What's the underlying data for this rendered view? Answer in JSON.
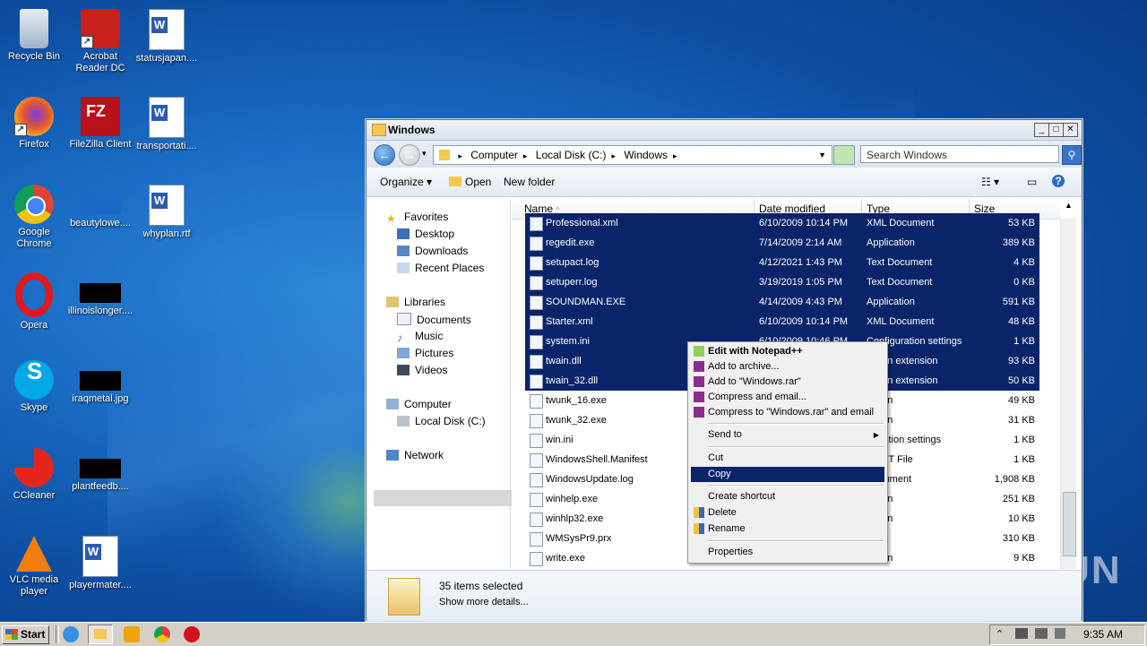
{
  "desktop": {
    "icons": [
      {
        "label": "Recycle Bin",
        "icon": "recycle-bin-icon"
      },
      {
        "label": "Acrobat Reader DC",
        "icon": "acrobat-icon"
      },
      {
        "label": "statusjapan....",
        "icon": "word-doc-icon"
      },
      {
        "label": "Firefox",
        "icon": "firefox-icon"
      },
      {
        "label": "FileZilla Client",
        "icon": "filezilla-icon"
      },
      {
        "label": "transportati....",
        "icon": "word-doc-icon"
      },
      {
        "label": "Google Chrome",
        "icon": "chrome-icon"
      },
      {
        "label": "beautylowe....",
        "icon": "file-icon"
      },
      {
        "label": "whyplan.rtf",
        "icon": "word-doc-icon"
      },
      {
        "label": "Opera",
        "icon": "opera-icon"
      },
      {
        "label": "illinoislonger....",
        "icon": "file-icon"
      },
      {
        "label": "Skype",
        "icon": "skype-icon"
      },
      {
        "label": "iraqmetal.jpg",
        "icon": "image-icon"
      },
      {
        "label": "CCleaner",
        "icon": "ccleaner-icon"
      },
      {
        "label": "plantfeedb....",
        "icon": "file-icon"
      },
      {
        "label": "VLC media player",
        "icon": "vlc-icon"
      },
      {
        "label": "playermater....",
        "icon": "word-doc-icon"
      }
    ]
  },
  "window": {
    "title": "Windows",
    "breadcrumb": [
      "Computer",
      "Local Disk (C:)",
      "Windows"
    ],
    "search_placeholder": "Search Windows",
    "toolbar": {
      "organize": "Organize",
      "open": "Open",
      "new_folder": "New folder"
    },
    "nav": {
      "favorites": "Favorites",
      "desktop": "Desktop",
      "downloads": "Downloads",
      "recent": "Recent Places",
      "libraries": "Libraries",
      "documents": "Documents",
      "music": "Music",
      "pictures": "Pictures",
      "videos": "Videos",
      "computer": "Computer",
      "local_disk": "Local Disk (C:)",
      "network": "Network"
    },
    "columns": {
      "name": "Name",
      "date": "Date modified",
      "type": "Type",
      "size": "Size"
    },
    "rows": [
      {
        "name": "Professional.xml",
        "date": "6/10/2009 10:14 PM",
        "type": "XML Document",
        "size": "53 KB"
      },
      {
        "name": "regedit.exe",
        "date": "7/14/2009 2:14 AM",
        "type": "Application",
        "size": "389 KB"
      },
      {
        "name": "setupact.log",
        "date": "4/12/2021 1:43 PM",
        "type": "Text Document",
        "size": "4 KB"
      },
      {
        "name": "setuperr.log",
        "date": "3/19/2019 1:05 PM",
        "type": "Text Document",
        "size": "0 KB"
      },
      {
        "name": "SOUNDMAN.EXE",
        "date": "4/14/2009 4:43 PM",
        "type": "Application",
        "size": "591 KB"
      },
      {
        "name": "Starter.xml",
        "date": "6/10/2009 10:14 PM",
        "type": "XML Document",
        "size": "48 KB"
      },
      {
        "name": "system.ini",
        "date": "6/10/2009 10:46 PM",
        "type": "Configuration settings",
        "size": "1 KB"
      },
      {
        "name": "twain.dll",
        "date": "",
        "type": "cation extension",
        "size": "93 KB"
      },
      {
        "name": "twain_32.dll",
        "date": "",
        "type": "cation extension",
        "size": "50 KB"
      },
      {
        "name": "twunk_16.exe",
        "date": "",
        "type": "cation",
        "size": "49 KB"
      },
      {
        "name": "twunk_32.exe",
        "date": "",
        "type": "cation",
        "size": "31 KB"
      },
      {
        "name": "win.ini",
        "date": "",
        "type": "iguration settings",
        "size": "1 KB"
      },
      {
        "name": "WindowsShell.Manifest",
        "date": "",
        "type": "IFEST File",
        "size": "1 KB"
      },
      {
        "name": "WindowsUpdate.log",
        "date": "",
        "type": "Document",
        "size": "1,908 KB"
      },
      {
        "name": "winhelp.exe",
        "date": "",
        "type": "cation",
        "size": "251 KB"
      },
      {
        "name": "winhlp32.exe",
        "date": "",
        "type": "cation",
        "size": "10 KB"
      },
      {
        "name": "WMSysPr9.prx",
        "date": "",
        "type": "File",
        "size": "310 KB"
      },
      {
        "name": "write.exe",
        "date": "",
        "type": "cation",
        "size": "9 KB"
      }
    ],
    "status": {
      "selected": "35 items selected",
      "details": "Show more details..."
    }
  },
  "context_menu": {
    "items": [
      {
        "label": "Edit with Notepad++",
        "bold": true
      },
      {
        "label": "Add to archive..."
      },
      {
        "label": "Add to \"Windows.rar\""
      },
      {
        "label": "Compress and email..."
      },
      {
        "label": "Compress to \"Windows.rar\" and email"
      },
      {
        "label": "Send to"
      },
      {
        "label": "Cut"
      },
      {
        "label": "Copy"
      },
      {
        "label": "Create shortcut"
      },
      {
        "label": "Delete"
      },
      {
        "label": "Rename"
      },
      {
        "label": "Properties"
      }
    ],
    "highlighted": "Copy"
  },
  "taskbar": {
    "start": "Start",
    "clock": "9:35 AM"
  },
  "watermark": "ANY RUN"
}
